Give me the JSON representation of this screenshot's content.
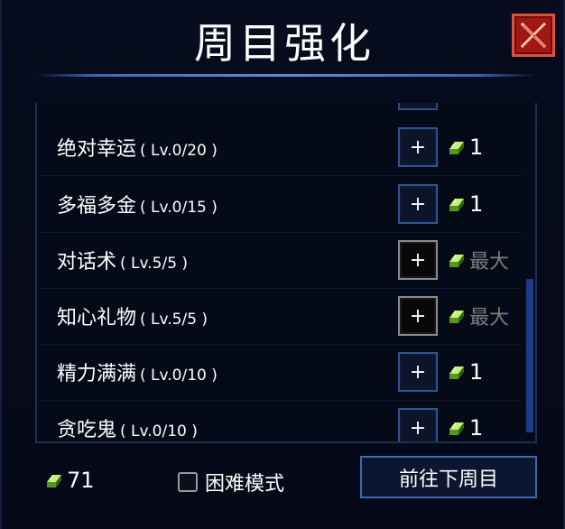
{
  "header": {
    "title": "周目强化"
  },
  "icons": {
    "close": "close-x-icon",
    "currency": "green-gem-icon"
  },
  "colors": {
    "close_bg": "#a31712",
    "accent": "#3c69b2",
    "maxed_text": "#7c7c7c",
    "gem_green": "#8ed43a"
  },
  "upgrades": [
    {
      "name": "绝对幸运",
      "level": "( Lv.0/20 )",
      "button": "+",
      "cost": "1",
      "maxed": false
    },
    {
      "name": "多福多金",
      "level": "( Lv.0/15 )",
      "button": "+",
      "cost": "1",
      "maxed": false
    },
    {
      "name": "对话术",
      "level": "( Lv.5/5 )",
      "button": "+",
      "cost": "最大",
      "maxed": true
    },
    {
      "name": "知心礼物",
      "level": "( Lv.5/5 )",
      "button": "+",
      "cost": "最大",
      "maxed": true
    },
    {
      "name": "精力满满",
      "level": "( Lv.0/10 )",
      "button": "+",
      "cost": "1",
      "maxed": false
    },
    {
      "name": "贪吃鬼",
      "level": "( Lv.0/10 )",
      "button": "+",
      "cost": "1",
      "maxed": false
    }
  ],
  "footer": {
    "currency_amount": "71",
    "hard_mode_label": "困难模式",
    "hard_mode_checked": false,
    "next_button_label": "前往下周目"
  }
}
